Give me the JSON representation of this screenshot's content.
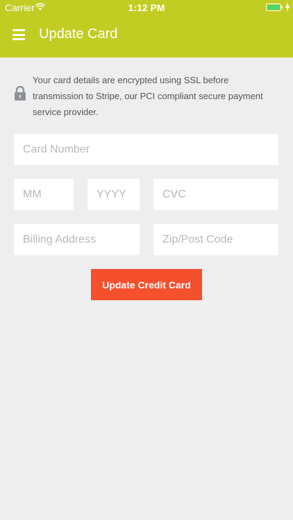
{
  "status_bar": {
    "carrier": "Carrier",
    "time": "1:12 PM",
    "icons": [
      "wifi-icon",
      "battery-icon",
      "charging-bolt-icon"
    ]
  },
  "header": {
    "title": "Update Card",
    "menu_icon": "hamburger-menu-icon",
    "background_color": "#c2cd23"
  },
  "notice": {
    "icon": "lock-icon",
    "text": "Your card details are encrypted using SSL before transmission to Stripe, our PCI compliant secure payment service provider."
  },
  "form": {
    "card_number": {
      "placeholder": "Card Number",
      "value": ""
    },
    "exp_month": {
      "placeholder": "MM",
      "value": ""
    },
    "exp_year": {
      "placeholder": "YYYY",
      "value": ""
    },
    "cvc": {
      "placeholder": "CVC",
      "value": ""
    },
    "billing_address": {
      "placeholder": "Billing Address",
      "value": ""
    },
    "zip_code": {
      "placeholder": "Zip/Post Code",
      "value": ""
    },
    "submit_label": "Update Credit Card",
    "submit_color": "#f4502e"
  }
}
